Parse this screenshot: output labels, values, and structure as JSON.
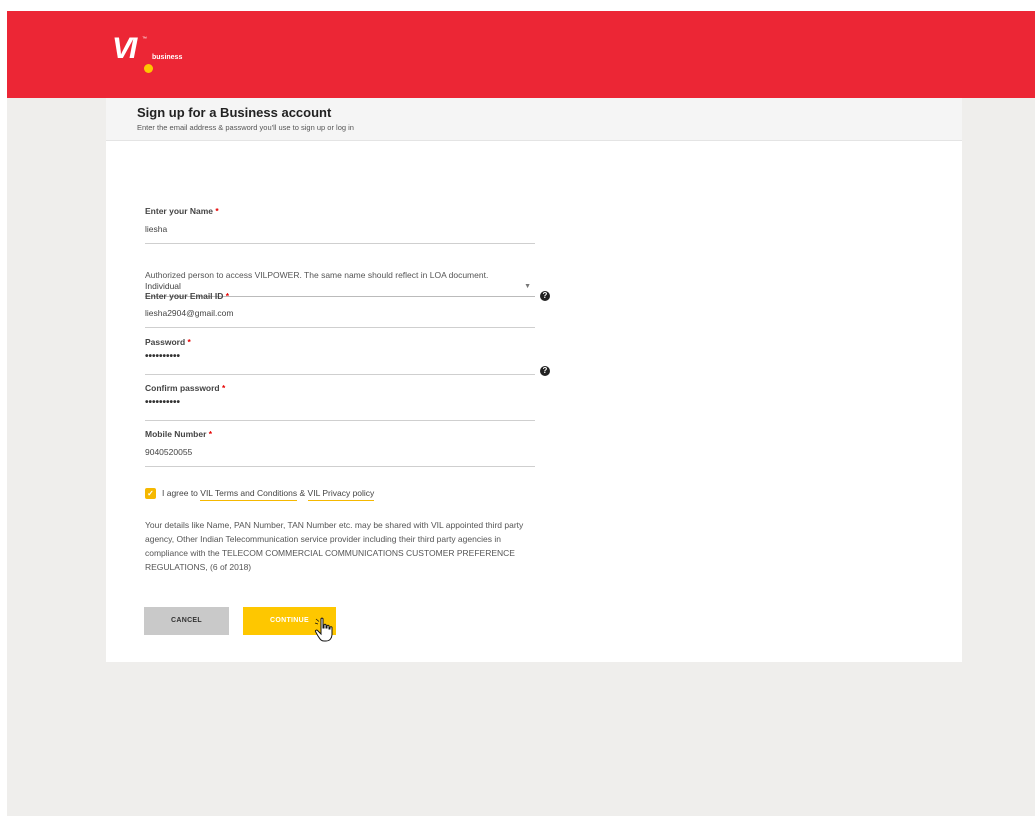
{
  "brand": {
    "logo_text": "VI",
    "logo_sub": "business",
    "colors": {
      "primary": "#ec2635",
      "accent": "#fec700"
    }
  },
  "form_header": {
    "title": "Sign up for a Business account",
    "subtitle": "Enter the email address & password you'll use to sign up or log in"
  },
  "account_type": {
    "selected": "Individual"
  },
  "name_field": {
    "label": "Enter your Name",
    "value": "liesha"
  },
  "name_helper": "Authorized person to access VILPOWER. The same name should reflect in LOA document.",
  "email_field": {
    "label": "Enter your Email ID",
    "value": "liesha2904@gmail.com"
  },
  "password_field": {
    "label": "Password",
    "value": "••••••••••"
  },
  "confirm_password_field": {
    "label": "Confirm password",
    "value": "••••••••••"
  },
  "mobile_field": {
    "label": "Mobile Number",
    "value": "9040520055"
  },
  "agreement": {
    "checked": true,
    "prefix": "I agree to ",
    "terms_link": "VIL Terms and Conditions",
    "separator": " & ",
    "privacy_link": "VIL Privacy policy"
  },
  "disclaimer": "Your details like Name, PAN Number, TAN Number etc. may be shared with VIL appointed third party agency, Other Indian Telecommunication service provider including their third party agencies in compliance with the TELECOM COMMERCIAL COMMUNICATIONS CUSTOMER PREFERENCE REGULATIONS, (6 of 2018)",
  "buttons": {
    "cancel": "CANCEL",
    "continue": "CONTINUE"
  },
  "required_marker": "*",
  "help_glyph": "?"
}
